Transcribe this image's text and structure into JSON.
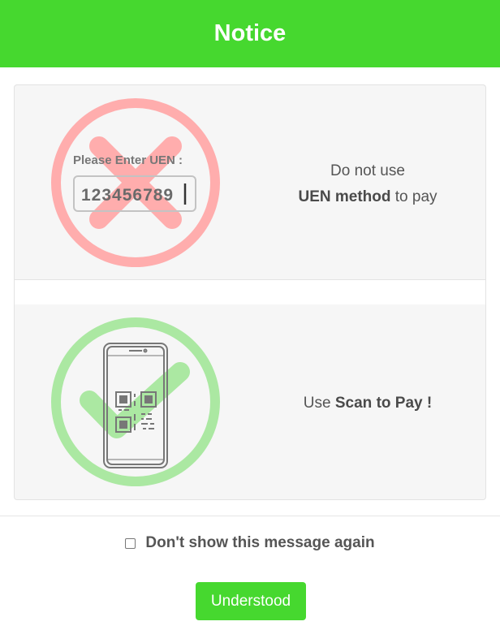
{
  "colors": {
    "brand_green": "#46d82f",
    "forbid_red": "#ffadad",
    "allow_green": "#abe8a2"
  },
  "header": {
    "title": "Notice"
  },
  "uen_panel": {
    "illustration": {
      "field_label": "Please Enter UEN :",
      "field_value": "123456789",
      "overlay_icon": "cross-in-circle-icon"
    },
    "line1": "Do not use",
    "line2_bold": "UEN method",
    "line2_rest": " to pay"
  },
  "scan_panel": {
    "illustration": {
      "phone_icon": "phone-qr-icon",
      "overlay_icon": "check-in-circle-icon"
    },
    "prefix": "Use ",
    "bold": "Scan to Pay !"
  },
  "footer": {
    "checkbox_label": "Don't show this message again",
    "checkbox_checked": false,
    "button_label": "Understood"
  }
}
